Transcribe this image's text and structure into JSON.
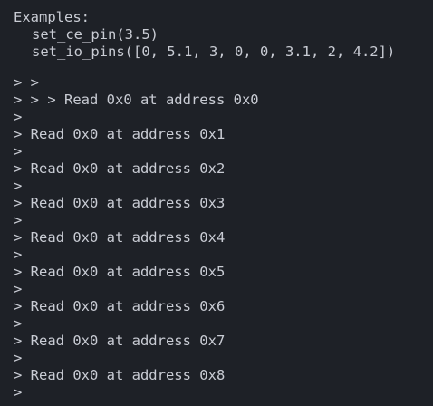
{
  "terminal": {
    "examples": {
      "header": "Examples:",
      "lines": [
        "set_ce_pin(3.5)",
        "set_io_pins([0, 5.1, 3, 0, 0, 3.1, 2, 4.2])"
      ]
    },
    "output": [
      "> >",
      "> > > Read 0x0 at address 0x0",
      ">",
      "> Read 0x0 at address 0x1",
      ">",
      "> Read 0x0 at address 0x2",
      ">",
      "> Read 0x0 at address 0x3",
      ">",
      "> Read 0x0 at address 0x4",
      ">",
      "> Read 0x0 at address 0x5",
      ">",
      "> Read 0x0 at address 0x6",
      ">",
      "> Read 0x0 at address 0x7",
      ">",
      "> Read 0x0 at address 0x8",
      ">"
    ]
  }
}
